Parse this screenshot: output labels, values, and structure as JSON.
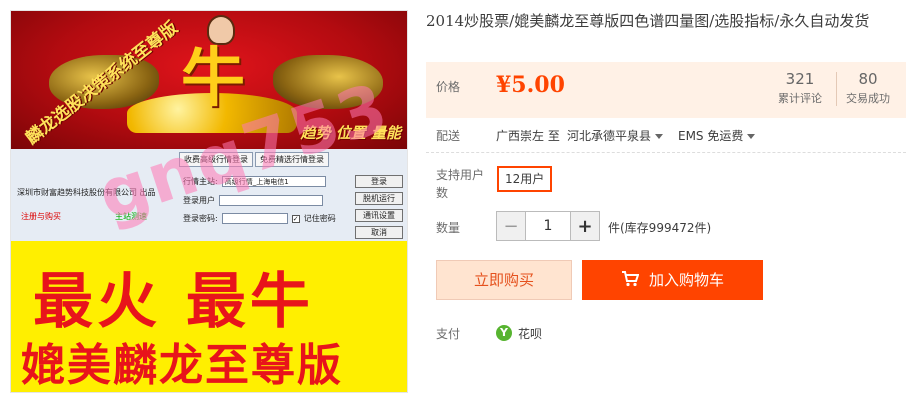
{
  "image": {
    "banner_title": "麟龙选股决策系统至尊版",
    "big_char": "牛",
    "banner_slogan": "趋势 位置 量能",
    "login": {
      "tab_1": "收费高级行情登录",
      "tab_2": "免费精选行情登录",
      "company": "深圳市财富趋势科技股份有限公司 出品",
      "register": "注册与购买",
      "site": "主站测速",
      "server_label": "行情主站:",
      "server_value": "高级行情_上海电信1",
      "user_label": "登录用户",
      "password_label": "登录密码:",
      "remember_label": "记住密码",
      "login_btn": "登录",
      "offline_btn": "脱机运行",
      "settings_btn": "通讯设置",
      "cancel_btn": "取消"
    },
    "slogan_big": "最火 最牛",
    "slogan_product": "媲美麟龙至尊版",
    "watermark": "gnq753"
  },
  "product": {
    "title": "2014炒股票/媲美麟龙至尊版四色谱四量图/选股指标/永久自动发货"
  },
  "price_panel": {
    "label": "价格",
    "price": "¥5.00",
    "reviews_count": "321",
    "reviews_label": "累计评论",
    "deals_count": "80",
    "deals_label": "交易成功"
  },
  "shipping": {
    "label": "配送",
    "from_to": "广西崇左 至",
    "destination": "河北承德平泉县",
    "method": "EMS 免运费"
  },
  "options": {
    "label": "支持用户数",
    "selected": "12用户"
  },
  "quantity": {
    "label": "数量",
    "minus": "−",
    "value": "1",
    "plus": "+",
    "stock": "件(库存999472件)"
  },
  "actions": {
    "buy_now": "立即购买",
    "add_to_cart": "加入购物车"
  },
  "payment": {
    "label": "支付",
    "icon_glyph": "Y",
    "method": "花呗"
  },
  "colors": {
    "accent": "#ff4400",
    "price": "#ff4400",
    "price_panel_bg": "#fff1e6",
    "buy_now_bg": "#ffe4d0",
    "huabei_green": "#57b430"
  },
  "icons": [
    "caret-down-icon",
    "cart-icon",
    "huabei-icon"
  ]
}
